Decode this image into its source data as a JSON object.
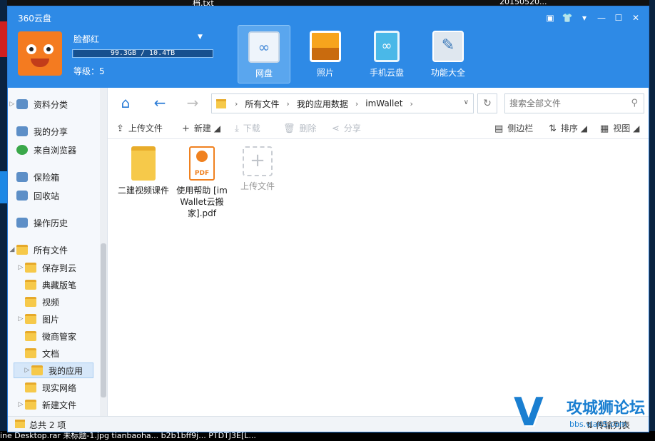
{
  "desktop": {
    "top_text_1": "档.txt",
    "top_text_2": "20150520...",
    "taskbar_text": "ine Desktop.rar  未标题-1.jpg  tianbaoha...  b2b1bff9j...                          PTDTJ3E[L..."
  },
  "window": {
    "app_title": "360云盘",
    "controls": [
      "▣",
      "👕",
      "▾",
      "—",
      "☐",
      "✕"
    ]
  },
  "user": {
    "name": "脸都红",
    "quota_text": "99.3GB / 10.4TB",
    "quota_fraction": 0.01,
    "level": "等级：5"
  },
  "nav_tabs": [
    {
      "label": "网盘",
      "icon": "cloud-disk-icon",
      "active": true
    },
    {
      "label": "照片",
      "icon": "photo-icon",
      "active": false
    },
    {
      "label": "手机云盘",
      "icon": "phone-cloud-icon",
      "active": false
    },
    {
      "label": "功能大全",
      "icon": "tools-icon",
      "active": false
    }
  ],
  "sidebar": {
    "items": [
      {
        "label": "资料分类",
        "icon": "docs-icon",
        "arrow": "▷"
      },
      {
        "label": "我的分享",
        "icon": "share-icon",
        "arrow": ""
      },
      {
        "label": "来自浏览器",
        "icon": "browser-icon",
        "arrow": ""
      },
      {
        "label": "保险箱",
        "icon": "safe-icon",
        "arrow": ""
      },
      {
        "label": "回收站",
        "icon": "trash-icon",
        "arrow": ""
      },
      {
        "label": "操作历史",
        "icon": "history-icon",
        "arrow": ""
      },
      {
        "label": "所有文件",
        "icon": "folder-icon",
        "arrow": "◢"
      },
      {
        "label": "保存到云",
        "icon": "folder-icon",
        "arrow": "▷"
      },
      {
        "label": "典藏版笔",
        "icon": "folder-icon",
        "arrow": ""
      },
      {
        "label": "视频",
        "icon": "folder-icon",
        "arrow": ""
      },
      {
        "label": "图片",
        "icon": "folder-icon",
        "arrow": "▷"
      },
      {
        "label": "微商管家",
        "icon": "folder-icon",
        "arrow": ""
      },
      {
        "label": "文档",
        "icon": "folder-icon",
        "arrow": ""
      },
      {
        "label": "我的应用",
        "icon": "folder-icon",
        "arrow": "▷"
      },
      {
        "label": "现实网络",
        "icon": "folder-icon",
        "arrow": ""
      },
      {
        "label": "新建文件",
        "icon": "folder-icon",
        "arrow": "▷"
      }
    ]
  },
  "address": {
    "crumbs": [
      "所有文件",
      "我的应用数据",
      "imWallet"
    ],
    "search_placeholder": "搜索全部文件"
  },
  "toolbar": {
    "upload": "上传文件",
    "new": "新建",
    "download": "下载",
    "delete": "删除",
    "share": "分享",
    "sidebar": "侧边栏",
    "sort": "排序",
    "view": "视图"
  },
  "files": [
    {
      "name": "二建视频课件",
      "type": "folder"
    },
    {
      "name": "使用帮助 [imWallet云搬家].pdf",
      "type": "pdf",
      "badge": "PDF"
    },
    {
      "name": "上传文件",
      "type": "upload"
    }
  ],
  "status": {
    "count": "总共 2 项",
    "transfer": "传输列表"
  },
  "watermark": {
    "logo": "V",
    "text": "攻城狮论坛",
    "url": "bbs.vlan5.com"
  }
}
